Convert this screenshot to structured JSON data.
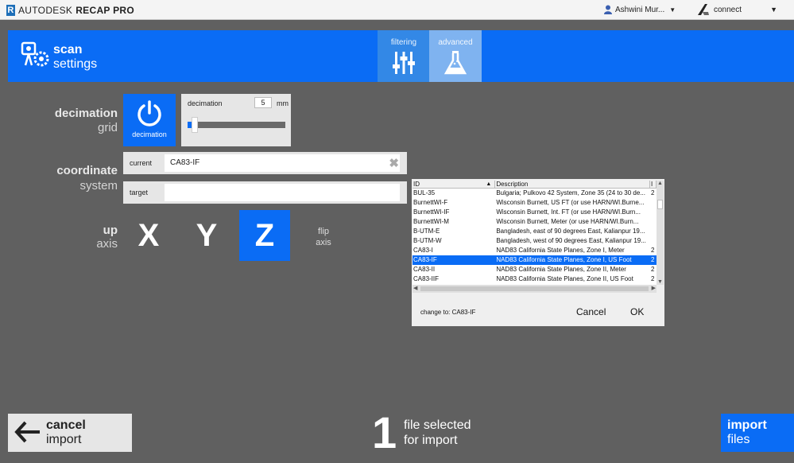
{
  "topbar": {
    "brand_light": "AUTODESK",
    "brand_bold": "RECAP PRO",
    "user_name": "Ashwini Mur...",
    "connect_label": "connect"
  },
  "header": {
    "title_bold": "scan",
    "title_light": "settings",
    "tabs": [
      {
        "label": "filtering",
        "icon": "sliders-icon"
      },
      {
        "label": "advanced",
        "icon": "flask-icon"
      }
    ]
  },
  "decimation": {
    "label_bold": "decimation",
    "label_light": "grid",
    "button_label": "decimation",
    "field_label": "decimation",
    "value": "5",
    "unit": "mm",
    "slider_fraction": 0.04
  },
  "coordinate": {
    "label_bold": "coordinate",
    "label_light": "system",
    "current_label": "current",
    "current_value": "CA83-IF",
    "target_label": "target",
    "target_value": ""
  },
  "up_axis": {
    "label_bold": "up",
    "label_light": "axis",
    "options": [
      "X",
      "Y",
      "Z"
    ],
    "selected": "Z",
    "flip_line1": "flip",
    "flip_line2": "axis"
  },
  "cs_list": {
    "columns": [
      "ID",
      "Description",
      "I"
    ],
    "rows": [
      {
        "id": "BUL-35",
        "desc": "Bulgaria; Pulkovo 42 System, Zone 35 (24 to 30 de...",
        "x": "2"
      },
      {
        "id": "BurnettWI-F",
        "desc": "Wisconsin Burnett, US FT (or use HARN/WI.Burne...",
        "x": ""
      },
      {
        "id": "BurnettWI-IF",
        "desc": "Wisconsin Burnett, Int. FT (or use HARN/WI.Burn...",
        "x": ""
      },
      {
        "id": "BurnettWI-M",
        "desc": "Wisconsin Burnett, Meter (or use HARN/WI.Burn...",
        "x": ""
      },
      {
        "id": "B-UTM-E",
        "desc": "Bangladesh, east of 90 degrees East, Kalianpur 19...",
        "x": ""
      },
      {
        "id": "B-UTM-W",
        "desc": "Bangladesh, west of 90 degrees East, Kalianpur 19...",
        "x": ""
      },
      {
        "id": "CA83-I",
        "desc": "NAD83 California State Planes, Zone I, Meter",
        "x": "2"
      },
      {
        "id": "CA83-IF",
        "desc": "NAD83 California State Planes, Zone I, US Foot",
        "x": "2"
      },
      {
        "id": "CA83-II",
        "desc": "NAD83 California State Planes, Zone II, Meter",
        "x": "2"
      },
      {
        "id": "CA83-IIF",
        "desc": "NAD83 California State Planes, Zone II, US Foot",
        "x": "2"
      }
    ],
    "selected_id": "CA83-IF",
    "change_to": "change to: CA83-IF",
    "cancel_label": "Cancel",
    "ok_label": "OK"
  },
  "footer": {
    "cancel_bold": "cancel",
    "cancel_light": "import",
    "count": "1",
    "selected_line1": "file selected",
    "selected_line2": "for import",
    "import_bold": "import",
    "import_light": "files"
  },
  "colors": {
    "accent": "#0a6cf5",
    "background": "#606060",
    "panel": "#e6e6e6"
  }
}
